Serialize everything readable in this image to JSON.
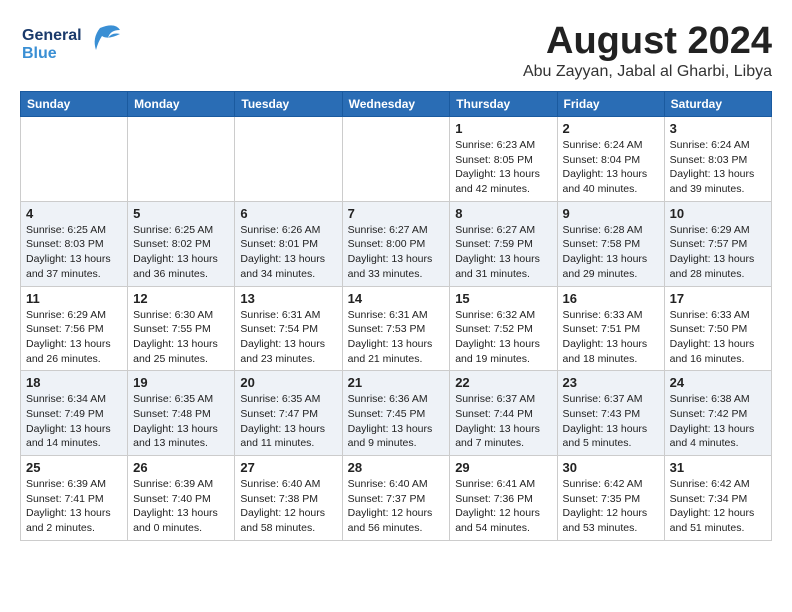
{
  "header": {
    "logo_general": "General",
    "logo_blue": "Blue",
    "month_title": "August 2024",
    "location": "Abu Zayyan, Jabal al Gharbi, Libya"
  },
  "calendar": {
    "days_of_week": [
      "Sunday",
      "Monday",
      "Tuesday",
      "Wednesday",
      "Thursday",
      "Friday",
      "Saturday"
    ],
    "weeks": [
      {
        "days": [
          {
            "num": "",
            "info": ""
          },
          {
            "num": "",
            "info": ""
          },
          {
            "num": "",
            "info": ""
          },
          {
            "num": "",
            "info": ""
          },
          {
            "num": "1",
            "info": "Sunrise: 6:23 AM\nSunset: 8:05 PM\nDaylight: 13 hours and 42 minutes."
          },
          {
            "num": "2",
            "info": "Sunrise: 6:24 AM\nSunset: 8:04 PM\nDaylight: 13 hours and 40 minutes."
          },
          {
            "num": "3",
            "info": "Sunrise: 6:24 AM\nSunset: 8:03 PM\nDaylight: 13 hours and 39 minutes."
          }
        ]
      },
      {
        "days": [
          {
            "num": "4",
            "info": "Sunrise: 6:25 AM\nSunset: 8:03 PM\nDaylight: 13 hours and 37 minutes."
          },
          {
            "num": "5",
            "info": "Sunrise: 6:25 AM\nSunset: 8:02 PM\nDaylight: 13 hours and 36 minutes."
          },
          {
            "num": "6",
            "info": "Sunrise: 6:26 AM\nSunset: 8:01 PM\nDaylight: 13 hours and 34 minutes."
          },
          {
            "num": "7",
            "info": "Sunrise: 6:27 AM\nSunset: 8:00 PM\nDaylight: 13 hours and 33 minutes."
          },
          {
            "num": "8",
            "info": "Sunrise: 6:27 AM\nSunset: 7:59 PM\nDaylight: 13 hours and 31 minutes."
          },
          {
            "num": "9",
            "info": "Sunrise: 6:28 AM\nSunset: 7:58 PM\nDaylight: 13 hours and 29 minutes."
          },
          {
            "num": "10",
            "info": "Sunrise: 6:29 AM\nSunset: 7:57 PM\nDaylight: 13 hours and 28 minutes."
          }
        ]
      },
      {
        "days": [
          {
            "num": "11",
            "info": "Sunrise: 6:29 AM\nSunset: 7:56 PM\nDaylight: 13 hours and 26 minutes."
          },
          {
            "num": "12",
            "info": "Sunrise: 6:30 AM\nSunset: 7:55 PM\nDaylight: 13 hours and 25 minutes."
          },
          {
            "num": "13",
            "info": "Sunrise: 6:31 AM\nSunset: 7:54 PM\nDaylight: 13 hours and 23 minutes."
          },
          {
            "num": "14",
            "info": "Sunrise: 6:31 AM\nSunset: 7:53 PM\nDaylight: 13 hours and 21 minutes."
          },
          {
            "num": "15",
            "info": "Sunrise: 6:32 AM\nSunset: 7:52 PM\nDaylight: 13 hours and 19 minutes."
          },
          {
            "num": "16",
            "info": "Sunrise: 6:33 AM\nSunset: 7:51 PM\nDaylight: 13 hours and 18 minutes."
          },
          {
            "num": "17",
            "info": "Sunrise: 6:33 AM\nSunset: 7:50 PM\nDaylight: 13 hours and 16 minutes."
          }
        ]
      },
      {
        "days": [
          {
            "num": "18",
            "info": "Sunrise: 6:34 AM\nSunset: 7:49 PM\nDaylight: 13 hours and 14 minutes."
          },
          {
            "num": "19",
            "info": "Sunrise: 6:35 AM\nSunset: 7:48 PM\nDaylight: 13 hours and 13 minutes."
          },
          {
            "num": "20",
            "info": "Sunrise: 6:35 AM\nSunset: 7:47 PM\nDaylight: 13 hours and 11 minutes."
          },
          {
            "num": "21",
            "info": "Sunrise: 6:36 AM\nSunset: 7:45 PM\nDaylight: 13 hours and 9 minutes."
          },
          {
            "num": "22",
            "info": "Sunrise: 6:37 AM\nSunset: 7:44 PM\nDaylight: 13 hours and 7 minutes."
          },
          {
            "num": "23",
            "info": "Sunrise: 6:37 AM\nSunset: 7:43 PM\nDaylight: 13 hours and 5 minutes."
          },
          {
            "num": "24",
            "info": "Sunrise: 6:38 AM\nSunset: 7:42 PM\nDaylight: 13 hours and 4 minutes."
          }
        ]
      },
      {
        "days": [
          {
            "num": "25",
            "info": "Sunrise: 6:39 AM\nSunset: 7:41 PM\nDaylight: 13 hours and 2 minutes."
          },
          {
            "num": "26",
            "info": "Sunrise: 6:39 AM\nSunset: 7:40 PM\nDaylight: 13 hours and 0 minutes."
          },
          {
            "num": "27",
            "info": "Sunrise: 6:40 AM\nSunset: 7:38 PM\nDaylight: 12 hours and 58 minutes."
          },
          {
            "num": "28",
            "info": "Sunrise: 6:40 AM\nSunset: 7:37 PM\nDaylight: 12 hours and 56 minutes."
          },
          {
            "num": "29",
            "info": "Sunrise: 6:41 AM\nSunset: 7:36 PM\nDaylight: 12 hours and 54 minutes."
          },
          {
            "num": "30",
            "info": "Sunrise: 6:42 AM\nSunset: 7:35 PM\nDaylight: 12 hours and 53 minutes."
          },
          {
            "num": "31",
            "info": "Sunrise: 6:42 AM\nSunset: 7:34 PM\nDaylight: 12 hours and 51 minutes."
          }
        ]
      }
    ]
  }
}
